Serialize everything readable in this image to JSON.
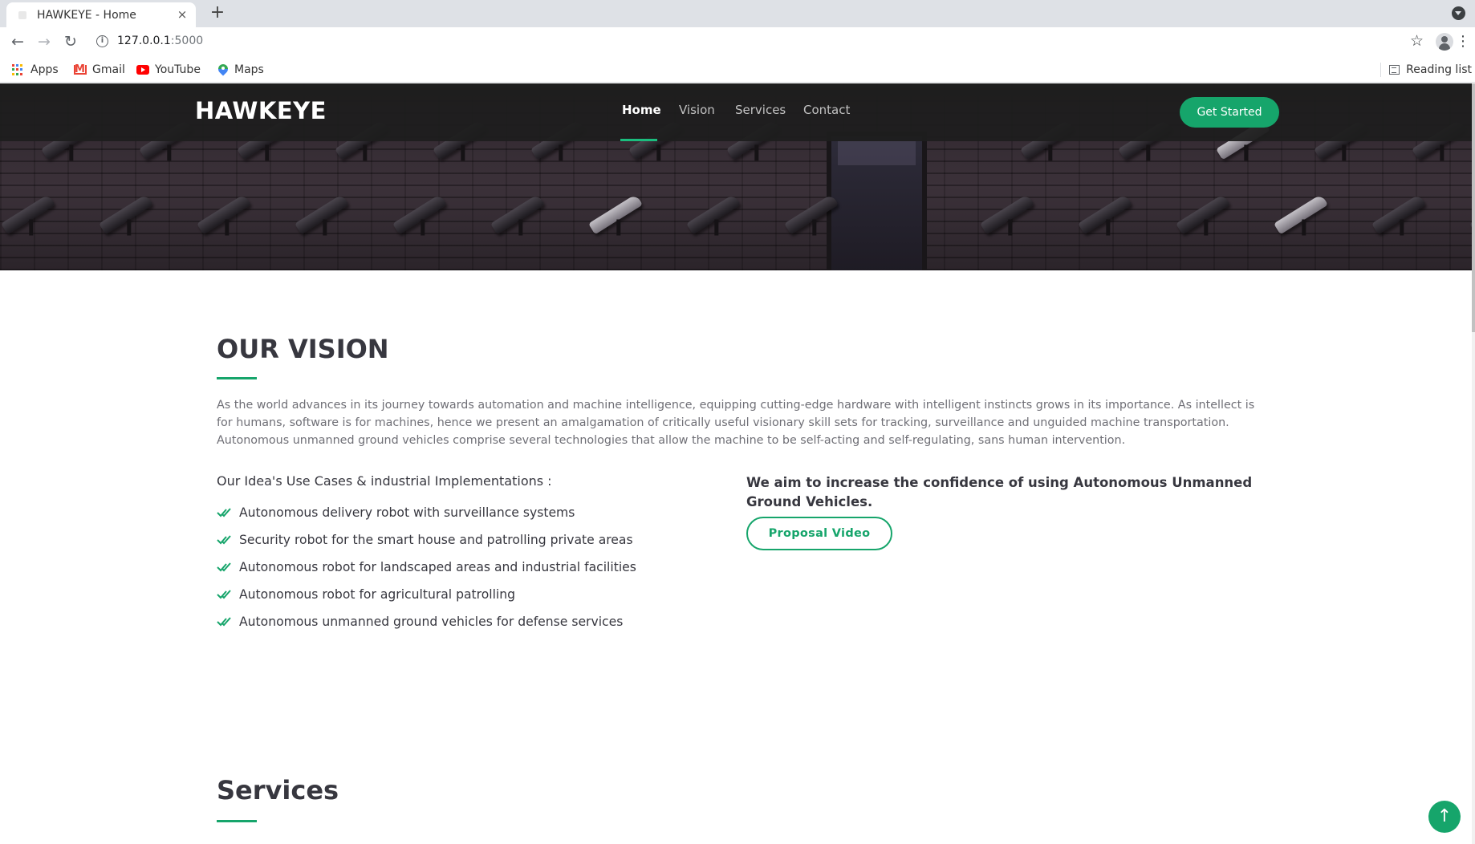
{
  "browser": {
    "tab_title": "HAWKEYE - Home",
    "new_tab_symbol": "+",
    "close_symbol": "×",
    "url_host": "127.0.0.1",
    "url_port": ":5000",
    "bookmarks": [
      {
        "label": "Apps",
        "icon": "apps-grid-icon"
      },
      {
        "label": "Gmail",
        "icon": "gmail-icon"
      },
      {
        "label": "YouTube",
        "icon": "youtube-icon"
      },
      {
        "label": "Maps",
        "icon": "maps-icon"
      }
    ],
    "reading_list": "Reading list"
  },
  "nav": {
    "logo": "HAWKEYE",
    "links": [
      {
        "label": "Home",
        "active": true
      },
      {
        "label": "Vision",
        "active": false
      },
      {
        "label": "Services",
        "active": false
      },
      {
        "label": "Contact",
        "active": false
      }
    ],
    "cta": "Get Started"
  },
  "vision": {
    "title": "OUR VISION",
    "paragraph": "As the world advances in its journey towards automation and machine intelligence, equipping cutting-edge hardware with intelligent instincts grows in its importance. As intellect is for humans, software is for machines, hence we present an amalgamation of critically useful visionary skill sets for tracking, surveillance and unguided machine transportation. Autonomous unmanned ground vehicles comprise several technologies that allow the machine to be self-acting and self-regulating, sans human intervention.",
    "uses_title": "Our Idea's Use Cases & industrial Implementations :",
    "uses": [
      "Autonomous delivery robot with surveillance systems",
      "Security robot for the smart house and patrolling private areas",
      "Autonomous robot for landscaped areas and industrial facilities",
      "Autonomous robot for agricultural patrolling",
      "Autonomous unmanned ground vehicles for defense services"
    ],
    "aim": "We aim to increase the confidence of using Autonomous Unmanned Ground Vehicles.",
    "video_button": "Proposal Video"
  },
  "services": {
    "title": "Services"
  },
  "colors": {
    "accent": "#16a56b",
    "navbar": "#1e1e1e",
    "heading": "#37373f"
  }
}
